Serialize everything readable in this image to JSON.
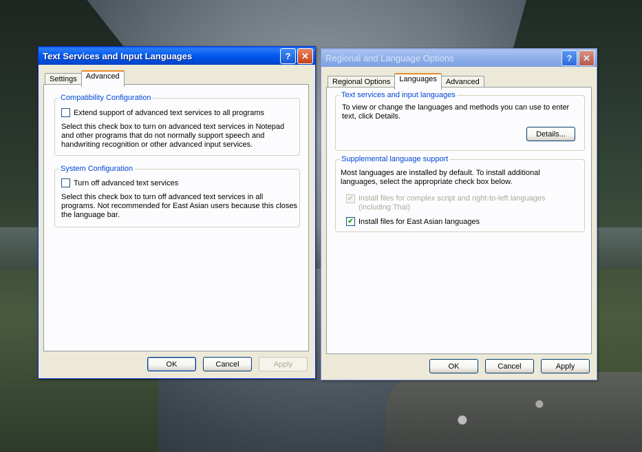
{
  "text_services_window": {
    "title": "Text Services and Input Languages",
    "help_glyph": "?",
    "close_glyph": "✕",
    "tabs": [
      {
        "label": "Settings",
        "active": false
      },
      {
        "label": "Advanced",
        "active": true
      }
    ],
    "compat_group": {
      "legend": "Compatibility Configuration",
      "checkbox_label": "Extend support of advanced text services to all programs",
      "checked": false,
      "description": "Select this check box to turn on advanced text services in Notepad and other programs that do not normally support speech and handwriting recognition or other advanced input services."
    },
    "system_group": {
      "legend": "System Configuration",
      "checkbox_label": "Turn off advanced text services",
      "checked": false,
      "description": "Select this check box to turn off advanced text services in all programs. Not recommended for East Asian users because this closes the language bar."
    },
    "buttons": {
      "ok": "OK",
      "cancel": "Cancel",
      "apply": "Apply"
    }
  },
  "regional_window": {
    "title": "Regional and Language Options",
    "help_glyph": "?",
    "close_glyph": "✕",
    "tabs": [
      {
        "label": "Regional Options",
        "active": false
      },
      {
        "label": "Languages",
        "active": true
      },
      {
        "label": "Advanced",
        "active": false
      }
    ],
    "text_services_group": {
      "legend": "Text services and input languages",
      "description": "To view or change the languages and methods you can use to enter text, click Details.",
      "details_button": "Details..."
    },
    "supplemental_group": {
      "legend": "Supplemental language support",
      "description": "Most languages are installed by default. To install additional languages, select the appropriate check box below.",
      "complex_script_label": "Install files for complex script and right-to-left languages (including Thai)",
      "complex_script_checked": true,
      "complex_script_disabled": true,
      "east_asian_label": "Install files for East Asian languages",
      "east_asian_checked": true
    },
    "buttons": {
      "ok": "OK",
      "cancel": "Cancel",
      "apply": "Apply"
    }
  },
  "check_glyph": "✔"
}
